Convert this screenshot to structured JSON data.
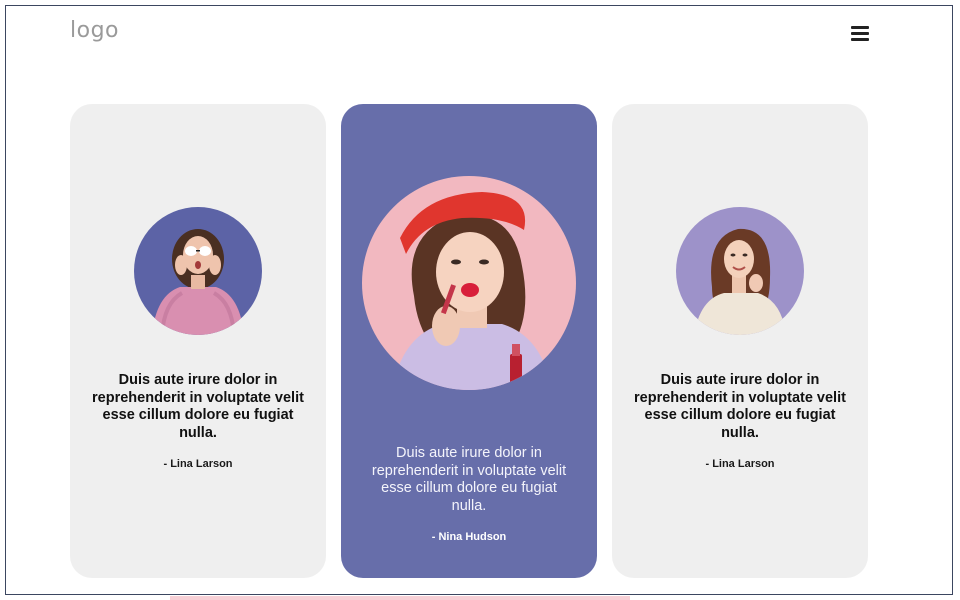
{
  "header": {
    "logo_text": "logo",
    "menu_icon": "hamburger-menu-icon"
  },
  "testimonials": [
    {
      "quote": "Duis aute irure dolor in reprehenderit in voluptate velit esse cillum dolore eu fugiat nulla.",
      "author": "- Lina Larson",
      "photo": "woman-sunglasses-pink-sweater-photo",
      "photo_bg": "#5c63a6"
    },
    {
      "quote": "Duis aute irure dolor in reprehenderit in voluptate velit esse cillum dolore eu fugiat nulla.",
      "author": "- Nina Hudson",
      "photo": "woman-red-beret-lipstick-photo",
      "photo_bg": "#f2b8c0"
    },
    {
      "quote": "Duis aute irure dolor in reprehenderit in voluptate velit esse cillum dolore eu fugiat nulla.",
      "author": "- Lina Larson",
      "photo": "woman-white-sweater-smiling-photo",
      "photo_bg": "#9d92c9"
    }
  ],
  "colors": {
    "card_bg": "#efefef",
    "card_active_bg": "#676eaa",
    "frame_border": "#3b4660"
  }
}
